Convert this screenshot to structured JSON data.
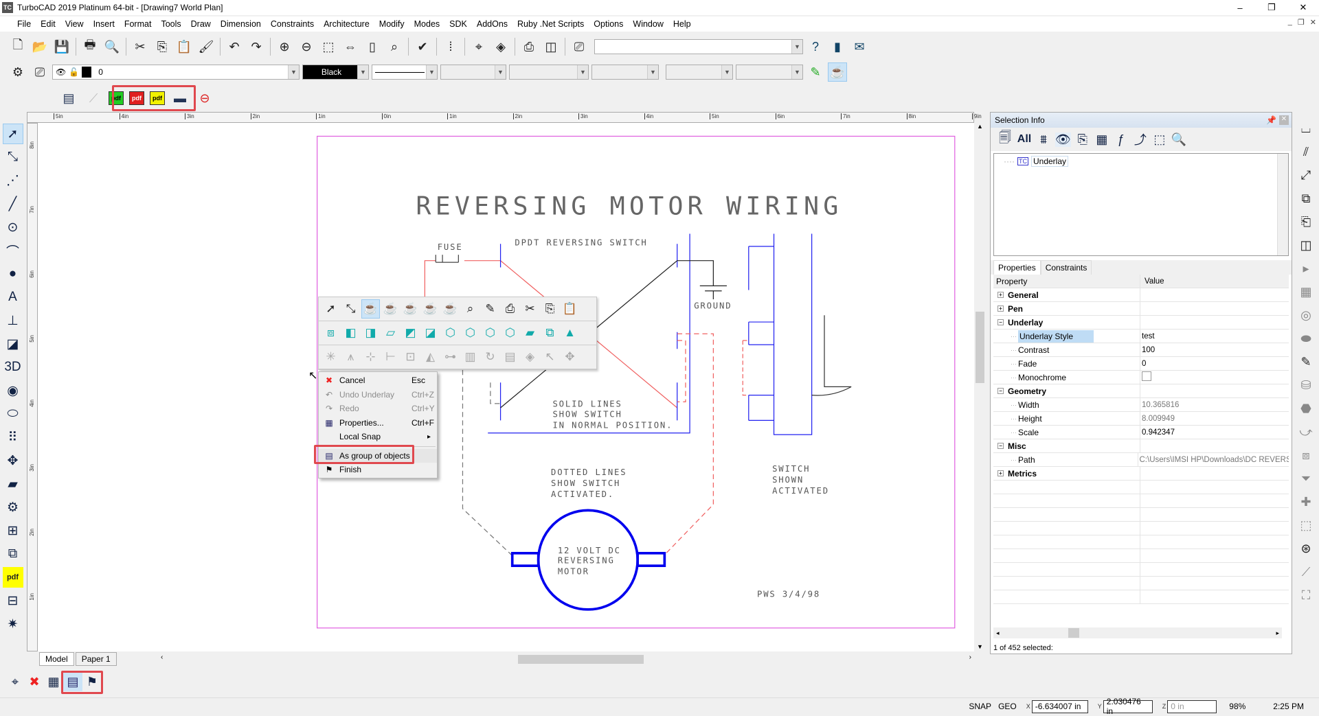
{
  "window": {
    "title": "TurboCAD 2019 Platinum 64-bit - [Drawing7 World Plan]",
    "logo": "TC",
    "controls": [
      "–",
      "❐",
      "✕"
    ],
    "mdi_controls": [
      "_",
      "❐",
      "✕"
    ]
  },
  "menu": [
    "File",
    "Edit",
    "View",
    "Insert",
    "Format",
    "Tools",
    "Draw",
    "Dimension",
    "Constraints",
    "Architecture",
    "Modify",
    "Modes",
    "SDK",
    "AddOns",
    "Ruby .Net Scripts",
    "Options",
    "Window",
    "Help"
  ],
  "toolbar1": {
    "icons": [
      {
        "name": "new",
        "g": "🗋"
      },
      {
        "name": "open",
        "g": "📂"
      },
      {
        "name": "save",
        "g": "💾"
      },
      {
        "name": "print",
        "g": "🖶"
      },
      {
        "name": "print-preview",
        "g": "🔍"
      },
      {
        "name": "cut",
        "g": "✂"
      },
      {
        "name": "copy",
        "g": "⎘"
      },
      {
        "name": "paste",
        "g": "📋"
      },
      {
        "name": "format-painter",
        "g": "🖌"
      },
      {
        "name": "undo",
        "g": "↶"
      },
      {
        "name": "redo",
        "g": "↷"
      },
      {
        "name": "zoom-in",
        "g": "⊕"
      },
      {
        "name": "zoom-out",
        "g": "⊖"
      },
      {
        "name": "zoom-window",
        "g": "⬚"
      },
      {
        "name": "zoom-extents",
        "g": "⇔"
      },
      {
        "name": "zoom-page",
        "g": "▯"
      },
      {
        "name": "zoom-all",
        "g": "⌕"
      },
      {
        "name": "spell-check",
        "g": "✔"
      },
      {
        "name": "grid",
        "g": "⁞"
      },
      {
        "name": "drawing-aids",
        "g": "⌖"
      },
      {
        "name": "selector",
        "g": "◈"
      },
      {
        "name": "insert-block",
        "g": "⎙"
      },
      {
        "name": "workplane",
        "g": "◫"
      },
      {
        "name": "drafting-palette",
        "g": "⎚"
      }
    ],
    "search_value": "",
    "help_icons": [
      {
        "name": "whats-this",
        "g": "?"
      },
      {
        "name": "book",
        "g": "▮"
      },
      {
        "name": "mail",
        "g": "✉"
      }
    ]
  },
  "toolbar2": {
    "layer_value": "0",
    "color_value": "Black",
    "colors": {
      "color_swatch": "#000000"
    }
  },
  "toolbar3": {
    "icons": [
      {
        "name": "bim",
        "g": "▤"
      },
      {
        "name": "line-tool",
        "g": "⟋"
      },
      {
        "name": "pdf-green",
        "g": "pdf",
        "bg": "#22cc22"
      },
      {
        "name": "pdf-red",
        "g": "pdf",
        "bg": "#e02020"
      },
      {
        "name": "pdf-yellow",
        "g": "pdf",
        "bg": "#f2f200"
      },
      {
        "name": "dash",
        "g": "▬"
      },
      {
        "name": "circle",
        "g": "⊖"
      }
    ]
  },
  "left_tools": [
    {
      "name": "select",
      "g": "➚"
    },
    {
      "name": "edit-node",
      "g": "⤡"
    },
    {
      "name": "point-line",
      "g": "⋰"
    },
    {
      "name": "line",
      "g": "╱"
    },
    {
      "name": "circle",
      "g": "⊙"
    },
    {
      "name": "arc",
      "g": "⌒"
    },
    {
      "name": "point",
      "g": "●"
    },
    {
      "name": "text",
      "g": "A"
    },
    {
      "name": "dimension",
      "g": "⊥"
    },
    {
      "name": "hatch",
      "g": "◪"
    },
    {
      "name": "3d-profile",
      "g": "3D"
    },
    {
      "name": "sphere",
      "g": "◉"
    },
    {
      "name": "extrude",
      "g": "⬭"
    },
    {
      "name": "array",
      "g": "⠿"
    },
    {
      "name": "move",
      "g": "✥"
    },
    {
      "name": "eraser",
      "g": "▰"
    },
    {
      "name": "settings",
      "g": "⚙"
    },
    {
      "name": "group",
      "g": "⊞"
    },
    {
      "name": "block",
      "g": "⧉"
    },
    {
      "name": "pdf-import",
      "g": "pdf"
    },
    {
      "name": "insert",
      "g": "⊟"
    },
    {
      "name": "light",
      "g": "✷"
    }
  ],
  "rulers": {
    "top": [
      "5in",
      "4in",
      "3in",
      "2in",
      "1in",
      "0in",
      "1in",
      "2in",
      "3in",
      "4in",
      "5in",
      "6in",
      "7in",
      "8in",
      "9in"
    ],
    "left": [
      "8in",
      "7in",
      "6in",
      "5in",
      "4in",
      "3in",
      "2in",
      "1in"
    ]
  },
  "drawing": {
    "title": "REVERSING MOTOR WIRING",
    "fuse": "FUSE",
    "switch_label": "DPDT REVERSING SWITCH",
    "ground": "GROUND",
    "solid_note": [
      "SOLID LINES",
      "SHOW SWITCH",
      "IN NORMAL POSITION."
    ],
    "dotted_note": [
      "DOTTED LINES",
      "SHOW SWITCH",
      "ACTIVATED."
    ],
    "activated_note": [
      "SWITCH",
      "SHOWN",
      "ACTIVATED"
    ],
    "motor": [
      "12 VOLT DC",
      "REVERSING",
      "MOTOR"
    ],
    "signature": "PWS   3/4/98",
    "colors": {
      "frame": "#e060e0",
      "blue": "#2020f0",
      "red": "#f06060",
      "motor": "#0000ee"
    }
  },
  "context_toolbar": {
    "rows": [
      [
        {
          "name": "select",
          "g": "➚"
        },
        {
          "name": "select-edit",
          "g": "⤡"
        },
        {
          "name": "render-wire",
          "g": "☕",
          "sel": true
        },
        {
          "name": "render-hidden",
          "g": "☕"
        },
        {
          "name": "render-draft",
          "g": "☕"
        },
        {
          "name": "render-quality",
          "g": "☕"
        },
        {
          "name": "render-redsdk",
          "g": "☕"
        },
        {
          "name": "zoom-selection",
          "g": "⌕"
        },
        {
          "name": "pen",
          "g": "✎"
        },
        {
          "name": "camera",
          "g": "⎙"
        },
        {
          "name": "cut",
          "g": "✂"
        },
        {
          "name": "copy",
          "g": "⎘"
        },
        {
          "name": "paste",
          "g": "📋"
        }
      ],
      [
        {
          "name": "workplane",
          "g": "⧈"
        },
        {
          "name": "view-front",
          "g": "◧"
        },
        {
          "name": "view-top",
          "g": "◨"
        },
        {
          "name": "view-left",
          "g": "▱"
        },
        {
          "name": "view-right",
          "g": "◩"
        },
        {
          "name": "view-back",
          "g": "◪"
        },
        {
          "name": "iso-1",
          "g": "⬡"
        },
        {
          "name": "iso-2",
          "g": "⬡"
        },
        {
          "name": "iso-3",
          "g": "⬡"
        },
        {
          "name": "iso-4",
          "g": "⬡"
        },
        {
          "name": "plane",
          "g": "▰"
        },
        {
          "name": "snap-object",
          "g": "⧉"
        },
        {
          "name": "tower",
          "g": "▲"
        }
      ],
      [
        {
          "name": "light-plane",
          "g": "✳"
        },
        {
          "name": "perspective",
          "g": "⩚"
        },
        {
          "name": "fit",
          "g": "⊹"
        },
        {
          "name": "axes",
          "g": "⊢"
        },
        {
          "name": "center",
          "g": "⊡"
        },
        {
          "name": "shade",
          "g": "◭"
        },
        {
          "name": "path",
          "g": "⊶"
        },
        {
          "name": "page",
          "g": "▥"
        },
        {
          "name": "rotate",
          "g": "↻"
        },
        {
          "name": "book",
          "g": "▤"
        },
        {
          "name": "cube-red",
          "g": "◈"
        },
        {
          "name": "pointer",
          "g": "↖"
        },
        {
          "name": "move-plane",
          "g": "✥"
        }
      ]
    ]
  },
  "context_menu": [
    {
      "label": "Cancel",
      "shortcut": "Esc",
      "icon": "✖",
      "icon_name": "cancel-icon",
      "disabled": false
    },
    {
      "label": "Undo Underlay",
      "shortcut": "Ctrl+Z",
      "icon": "↶",
      "icon_name": "undo-icon",
      "disabled": true
    },
    {
      "label": "Redo",
      "shortcut": "Ctrl+Y",
      "icon": "↷",
      "icon_name": "redo-icon",
      "disabled": true
    },
    {
      "label": "Properties...",
      "shortcut": "Ctrl+F",
      "icon": "▦",
      "icon_name": "properties-icon",
      "disabled": false
    },
    {
      "label": "Local Snap",
      "shortcut": "",
      "icon": "",
      "icon_name": "",
      "disabled": false,
      "submenu": "▸"
    },
    {
      "label": "As group of objects",
      "shortcut": "",
      "icon": "▤",
      "icon_name": "group-objects-icon",
      "disabled": false,
      "highlighted": true
    },
    {
      "label": "Finish",
      "shortcut": "",
      "icon": "⚑",
      "icon_name": "checkered-flag-icon",
      "disabled": false
    }
  ],
  "panel": {
    "title": "Selection Info",
    "toolbar": [
      {
        "name": "properties",
        "g": "🗐"
      },
      {
        "name": "all",
        "g": "All"
      },
      {
        "name": "filter",
        "g": "⩩"
      },
      {
        "name": "visibility",
        "g": "👁"
      },
      {
        "name": "copy-list",
        "g": "⎘"
      },
      {
        "name": "table",
        "g": "▦"
      },
      {
        "name": "formula",
        "g": "ƒ"
      },
      {
        "name": "node-edit",
        "g": "⤴"
      },
      {
        "name": "select-box",
        "g": "⬚"
      },
      {
        "name": "search",
        "g": "🔍"
      }
    ],
    "tree": [
      {
        "label": "Underlay",
        "icon": "TC"
      }
    ],
    "tabs": [
      "Properties",
      "Constraints"
    ],
    "columns": [
      "Property",
      "Value"
    ],
    "rows": [
      {
        "label": "General",
        "type": "group",
        "expanded": false,
        "value": ""
      },
      {
        "label": "Pen",
        "type": "group",
        "expanded": false,
        "value": ""
      },
      {
        "label": "Underlay",
        "type": "group",
        "expanded": true,
        "value": ""
      },
      {
        "label": "Underlay Style",
        "type": "item",
        "value": "test",
        "selected": true
      },
      {
        "label": "Contrast",
        "type": "item",
        "value": "100"
      },
      {
        "label": "Fade",
        "type": "item",
        "value": "0"
      },
      {
        "label": "Monochrome",
        "type": "check",
        "value": false
      },
      {
        "label": "Geometry",
        "type": "group",
        "expanded": true,
        "value": ""
      },
      {
        "label": "Width",
        "type": "item",
        "value": "10.365816",
        "readonly": true
      },
      {
        "label": "Height",
        "type": "item",
        "value": "8.009949",
        "readonly": true
      },
      {
        "label": "Scale",
        "type": "item",
        "value": "0.942347"
      },
      {
        "label": "Misc",
        "type": "group",
        "expanded": true,
        "value": ""
      },
      {
        "label": "Path",
        "type": "item",
        "value": "C:\\Users\\IMSI HP\\Downloads\\DC REVERS",
        "readonly": true
      },
      {
        "label": "Metrics",
        "type": "group",
        "expanded": false,
        "value": ""
      }
    ],
    "selection_count": "1 of 452 selected:"
  },
  "right_tools": [
    {
      "name": "wall",
      "g": "⌴"
    },
    {
      "name": "stairs",
      "g": "⫽"
    },
    {
      "name": "arrow-edit",
      "g": "⤢"
    },
    {
      "name": "copy-shape",
      "g": "⧉"
    },
    {
      "name": "export",
      "g": "⎗"
    },
    {
      "name": "layers",
      "g": "◫"
    },
    {
      "name": "small-arrow",
      "g": "▸"
    },
    {
      "name": "table",
      "g": "▦"
    },
    {
      "name": "rings",
      "g": "◎"
    },
    {
      "name": "blob",
      "g": "⬬"
    },
    {
      "name": "pencil-dots",
      "g": "✎"
    },
    {
      "name": "cylinder",
      "g": "⛁"
    },
    {
      "name": "box",
      "g": "⬣"
    },
    {
      "name": "arrow-return",
      "g": "⤻"
    },
    {
      "name": "cube-group",
      "g": "⧈"
    },
    {
      "name": "funnel",
      "g": "⏷"
    },
    {
      "name": "plus",
      "g": "✚"
    },
    {
      "name": "cube",
      "g": "⬚"
    },
    {
      "name": "target",
      "g": "⊛"
    },
    {
      "name": "line-node",
      "g": "⟋"
    },
    {
      "name": "transform",
      "g": "⛶"
    }
  ],
  "sheet_tabs": [
    {
      "label": "Model",
      "active": true
    },
    {
      "label": "Paper 1",
      "active": false
    }
  ],
  "bottom_tools": [
    {
      "name": "snap-tool",
      "g": "⌖"
    },
    {
      "name": "cancel",
      "g": "✖"
    },
    {
      "name": "table",
      "g": "▦"
    },
    {
      "name": "group-objects",
      "g": "▤"
    },
    {
      "name": "finish",
      "g": "⚑"
    }
  ],
  "status": {
    "snap": "SNAP",
    "geo": "GEO",
    "x": "-6.634007 in",
    "y": "2.030476 in",
    "z": "0 in",
    "zoom": "98%",
    "time": "2:25 PM"
  }
}
